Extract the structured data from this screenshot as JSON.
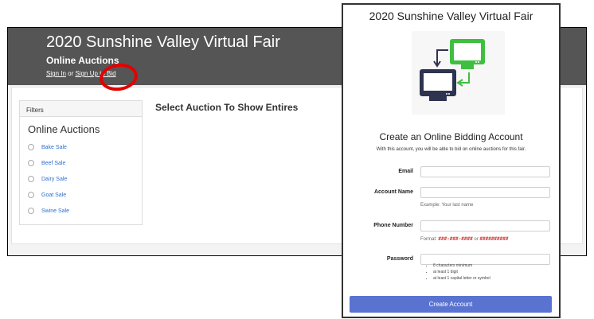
{
  "bg": {
    "title": "2020 Sunshine Valley Virtual Fair",
    "subtitle": "Online Auctions",
    "sign_in": "Sign In",
    "or": " or ",
    "sign_up": "Sign Up to Bid",
    "filters_label": "Filters",
    "filters_heading": "Online Auctions",
    "auctions": [
      "Bake Sale",
      "Beef Sale",
      "Dairy Sale",
      "Goat Sale",
      "Swine Sale"
    ],
    "select_title": "Select Auction To Show Entires"
  },
  "modal": {
    "title": "2020 Sunshine Valley Virtual Fair",
    "heading": "Create an Online Bidding Account",
    "description": "With this account, you will be able to bid on online auctions for this fair.",
    "email_label": "Email",
    "account_name_label": "Account Name",
    "account_name_hint": "Example: Your last name",
    "phone_label": "Phone Number",
    "phone_hint_prefix": "Format: ",
    "phone_format_1": "###-###-####",
    "phone_hint_or": " or ",
    "phone_format_2": "##########",
    "password_label": "Password",
    "password_rules": [
      "8 characters minimum",
      "at least 1 digit",
      "at least 1 capital letter or symbol"
    ],
    "create_button": "Create Account"
  },
  "colors": {
    "header_bg": "#555555",
    "link_blue": "#2f6fd0",
    "button_blue": "#5a73d0",
    "annotation_red": "#e30000",
    "icon_green": "#3fbf3f",
    "icon_navy": "#2e3350"
  },
  "icons": [
    "monitor-icon",
    "arrow-icon"
  ]
}
